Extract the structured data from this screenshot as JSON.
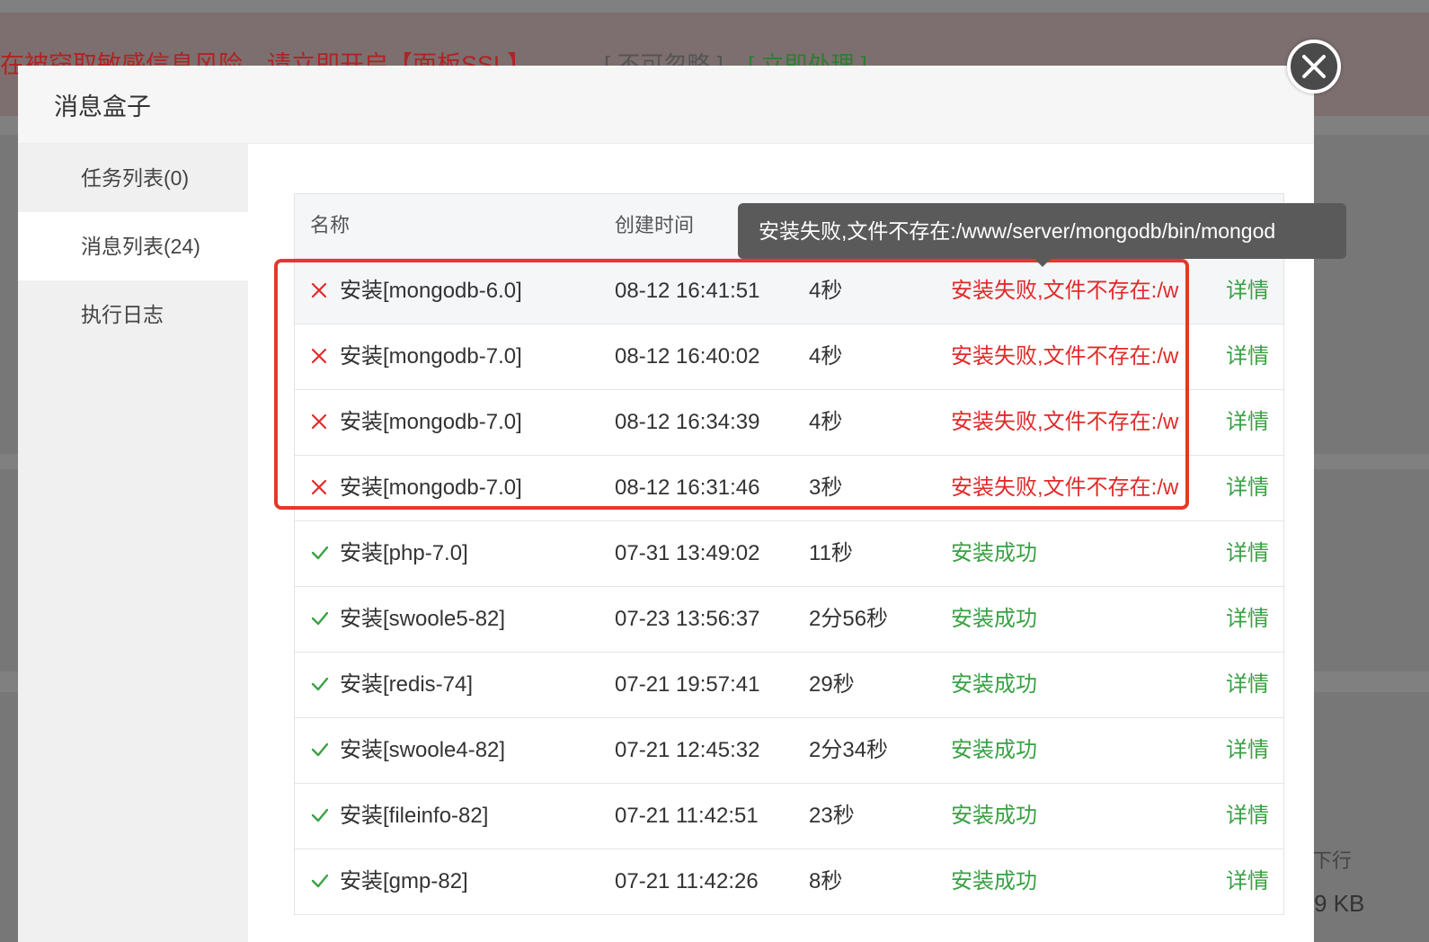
{
  "background": {
    "banner_text": "在被窃取敏感信息风险，请立即开启【面板SSL】",
    "ignore_label": "[ 不可忽略 ]",
    "handle_label": "[ 立即处理 ]",
    "stat_label": "下行",
    "stat_value": "9 KB"
  },
  "modal": {
    "title": "消息盒子"
  },
  "sidebar": {
    "items": [
      {
        "label": "任务列表(0)",
        "active": false
      },
      {
        "label": "消息列表(24)",
        "active": true
      },
      {
        "label": "执行日志",
        "active": false
      }
    ]
  },
  "table": {
    "headers": {
      "name": "名称",
      "time": "创建时间"
    },
    "detail_label": "详情",
    "rows": [
      {
        "status": "fail",
        "name": "安装[mongodb-6.0]",
        "time": "08-12 16:41:51",
        "duration": "4秒",
        "result": "安装失败,文件不存在:/w"
      },
      {
        "status": "fail",
        "name": "安装[mongodb-7.0]",
        "time": "08-12 16:40:02",
        "duration": "4秒",
        "result": "安装失败,文件不存在:/w"
      },
      {
        "status": "fail",
        "name": "安装[mongodb-7.0]",
        "time": "08-12 16:34:39",
        "duration": "4秒",
        "result": "安装失败,文件不存在:/w"
      },
      {
        "status": "fail",
        "name": "安装[mongodb-7.0]",
        "time": "08-12 16:31:46",
        "duration": "3秒",
        "result": "安装失败,文件不存在:/w"
      },
      {
        "status": "ok",
        "name": "安装[php-7.0]",
        "time": "07-31 13:49:02",
        "duration": "11秒",
        "result": "安装成功"
      },
      {
        "status": "ok",
        "name": "安装[swoole5-82]",
        "time": "07-23 13:56:37",
        "duration": "2分56秒",
        "result": "安装成功"
      },
      {
        "status": "ok",
        "name": "安装[redis-74]",
        "time": "07-21 19:57:41",
        "duration": "29秒",
        "result": "安装成功"
      },
      {
        "status": "ok",
        "name": "安装[swoole4-82]",
        "time": "07-21 12:45:32",
        "duration": "2分34秒",
        "result": "安装成功"
      },
      {
        "status": "ok",
        "name": "安装[fileinfo-82]",
        "time": "07-21 11:42:51",
        "duration": "23秒",
        "result": "安装成功"
      },
      {
        "status": "ok",
        "name": "安装[gmp-82]",
        "time": "07-21 11:42:26",
        "duration": "8秒",
        "result": "安装成功"
      }
    ]
  },
  "tooltip": {
    "text": "安装失败,文件不存在:/www/server/mongodb/bin/mongod"
  },
  "colors": {
    "fail": "#e02b2b",
    "ok": "#3aa144",
    "highlight": "#e4392a"
  }
}
